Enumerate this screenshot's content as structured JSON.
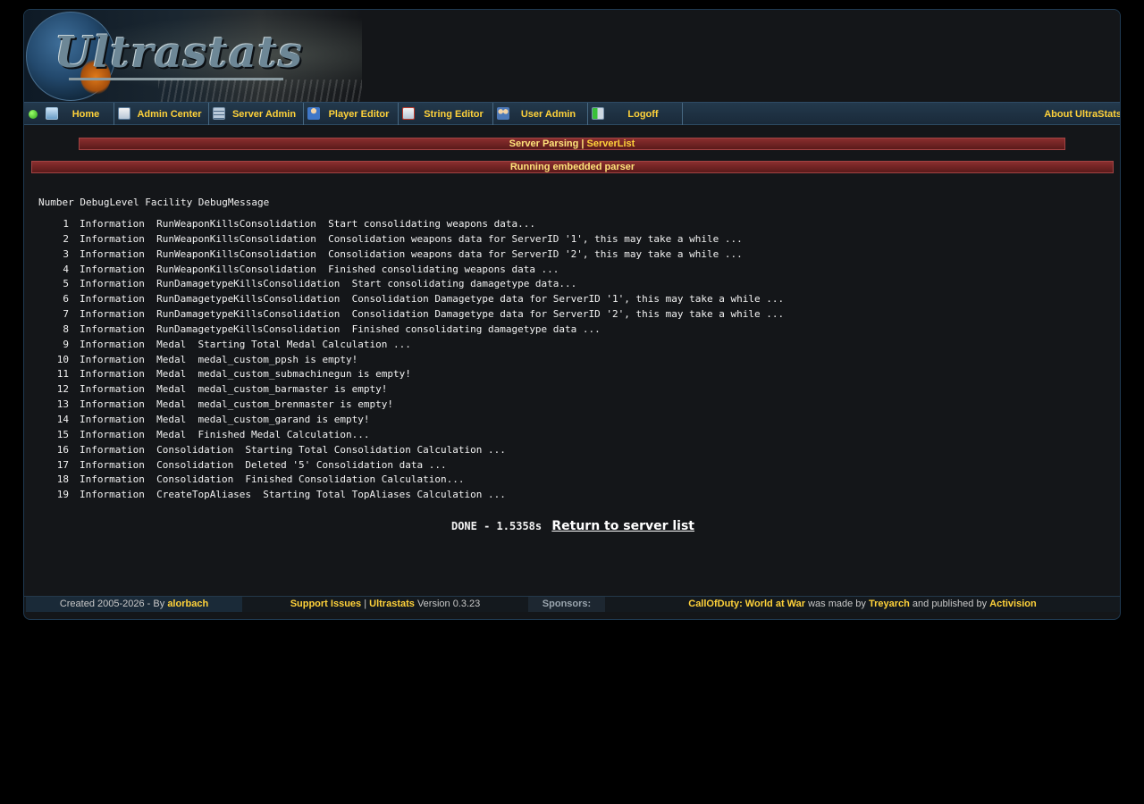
{
  "header": {
    "logo_text": "Ultrastats"
  },
  "nav": {
    "items": [
      {
        "label": "Home",
        "icon": "home-icon"
      },
      {
        "label": "Admin Center",
        "icon": "admin-icon"
      },
      {
        "label": "Server Admin",
        "icon": "server-icon"
      },
      {
        "label": "Player Editor",
        "icon": "player-icon"
      },
      {
        "label": "String Editor",
        "icon": "string-icon"
      },
      {
        "label": "User Admin",
        "icon": "users-icon"
      },
      {
        "label": "Logoff",
        "icon": "logoff-icon"
      }
    ],
    "about": "About UltraStats"
  },
  "titlebar1": {
    "text": "Server Parsing |",
    "link": "ServerList"
  },
  "titlebar2": {
    "text": "Running embedded parser"
  },
  "debug": {
    "header": "Number DebugLevel Facility DebugMessage",
    "rows": [
      {
        "num": "1",
        "line": "Information  RunWeaponKillsConsolidation  Start consolidating weapons data..."
      },
      {
        "num": "2",
        "line": "Information  RunWeaponKillsConsolidation  Consolidation weapons data for ServerID '1', this may take a while ..."
      },
      {
        "num": "3",
        "line": "Information  RunWeaponKillsConsolidation  Consolidation weapons data for ServerID '2', this may take a while ..."
      },
      {
        "num": "4",
        "line": "Information  RunWeaponKillsConsolidation  Finished consolidating weapons data ..."
      },
      {
        "num": "5",
        "line": "Information  RunDamagetypeKillsConsolidation  Start consolidating damagetype data..."
      },
      {
        "num": "6",
        "line": "Information  RunDamagetypeKillsConsolidation  Consolidation Damagetype data for ServerID '1', this may take a while ..."
      },
      {
        "num": "7",
        "line": "Information  RunDamagetypeKillsConsolidation  Consolidation Damagetype data for ServerID '2', this may take a while ..."
      },
      {
        "num": "8",
        "line": "Information  RunDamagetypeKillsConsolidation  Finished consolidating damagetype data ..."
      },
      {
        "num": "9",
        "line": "Information  Medal  Starting Total Medal Calculation ..."
      },
      {
        "num": "10",
        "line": "Information  Medal  medal_custom_ppsh is empty!"
      },
      {
        "num": "11",
        "line": "Information  Medal  medal_custom_submachinegun is empty!"
      },
      {
        "num": "12",
        "line": "Information  Medal  medal_custom_barmaster is empty!"
      },
      {
        "num": "13",
        "line": "Information  Medal  medal_custom_brenmaster is empty!"
      },
      {
        "num": "14",
        "line": "Information  Medal  medal_custom_garand is empty!"
      },
      {
        "num": "15",
        "line": "Information  Medal  Finished Medal Calculation..."
      },
      {
        "num": "16",
        "line": "Information  Consolidation  Starting Total Consolidation Calculation ..."
      },
      {
        "num": "17",
        "line": "Information  Consolidation  Deleted '5' Consolidation data ..."
      },
      {
        "num": "18",
        "line": "Information  Consolidation  Finished Consolidation Calculation..."
      },
      {
        "num": "19",
        "line": "Information  CreateTopAliases  Starting Total TopAliases Calculation ..."
      }
    ]
  },
  "done": {
    "text": "DONE - 1.5358s",
    "link": "Return to server list"
  },
  "footer": {
    "created": "Created 2005-2026 - By",
    "author": "alorbach",
    "support": "Support Issues",
    "sep": "|",
    "product": "Ultrastats",
    "version": "Version 0.3.23",
    "sponsors": "Sponsors:",
    "game": "CallOfDuty: World at War",
    "made_by": "was made by",
    "dev": "Treyarch",
    "published": "and published by",
    "publisher": "Activision"
  }
}
